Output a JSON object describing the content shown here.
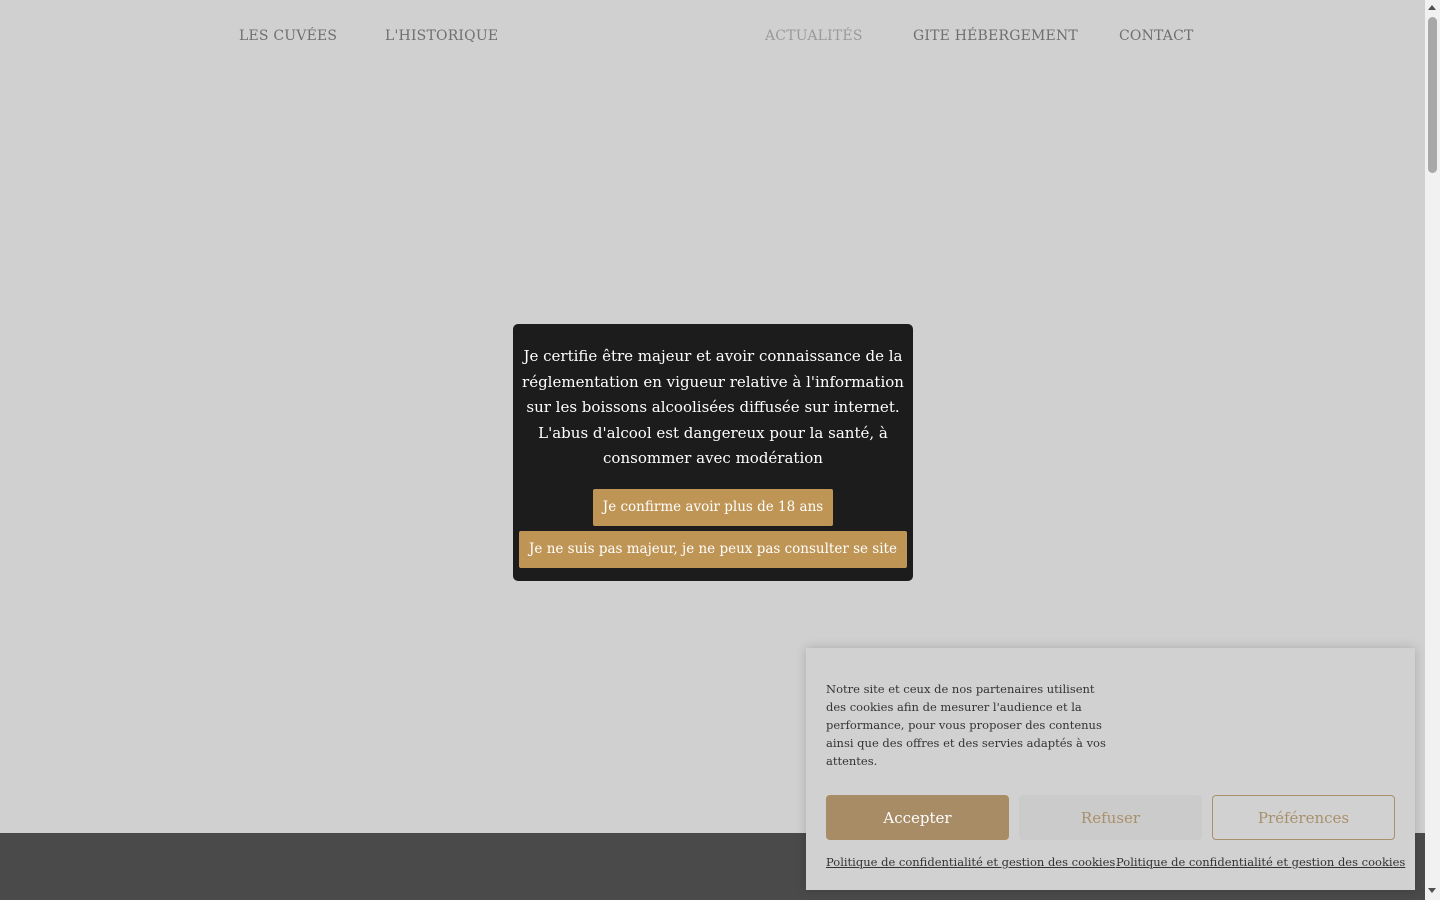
{
  "nav": {
    "items": [
      {
        "label": "LES CUVÉES"
      },
      {
        "label": "L'HISTORIQUE"
      },
      {
        "label": "ACTUALITÉS",
        "active": true
      },
      {
        "label": "GITE HÉBERGEMENT"
      },
      {
        "label": "CONTACT"
      }
    ]
  },
  "age_gate": {
    "message": "Je certifie être majeur et avoir connaissance de la réglementation en vigueur relative à l'information sur les boissons alcoolisées diffusée sur internet. L'abus d'alcool est dangereux pour la santé, à consommer avec modération",
    "confirm_label": "Je confirme avoir plus de 18 ans",
    "deny_label": "Je ne suis pas majeur, je ne peux pas consulter se site"
  },
  "cookie_banner": {
    "text": "Notre site et ceux de nos partenaires utilisent des cookies afin de mesurer l'audience et la performance, pour vous proposer des contenus ainsi que des offres et des servies adaptés à vos attentes.",
    "accept_label": "Accepter",
    "refuse_label": "Refuser",
    "preferences_label": "Préférences",
    "links": [
      {
        "label": "Politique de confidentialité et gestion des cookies"
      },
      {
        "label": "Politique de confidentialité et gestion des cookies"
      }
    ]
  },
  "colors": {
    "accent_gold": "#bf9556",
    "modal_bg": "#1c1c1c",
    "page_bg": "#d0d0d0",
    "footer_bg": "#4a4a4a"
  }
}
